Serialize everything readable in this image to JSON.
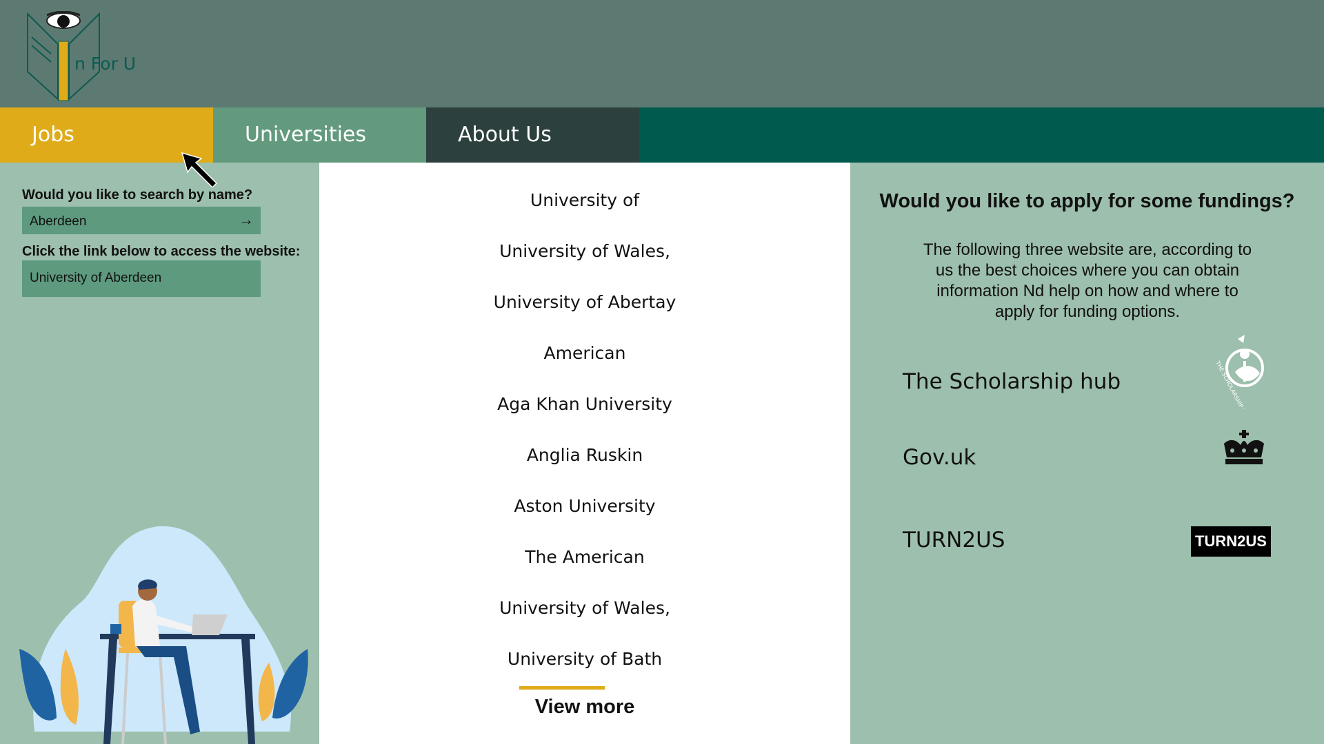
{
  "brand": {
    "logo_text": "n For U"
  },
  "nav": {
    "jobs": "Jobs",
    "universities": "Universities",
    "about": "About Us"
  },
  "left": {
    "search_label": "Would you like to search by name?",
    "search_value": "Aberdeen",
    "search_arrow": "→",
    "link_label": "Click the link below to access the website:",
    "link_value": "University of Aberdeen"
  },
  "universities": {
    "items": [
      "University of",
      "University of Wales,",
      "University of Abertay",
      "American",
      "Aga Khan University",
      "Anglia Ruskin",
      "Aston University",
      "The American",
      "University of Wales,",
      "University of Bath"
    ],
    "view_more": "View more"
  },
  "funding": {
    "title": "Would you like to apply for some fundings?",
    "description": "The following three website are, according to us the best choices where you can obtain information Nd help on how and where to apply for funding options.",
    "sites": [
      "The Scholarship hub",
      "Gov.uk",
      "TURN2US"
    ],
    "scholarship_logo_text": "THE SCHOLARSHIP HUB",
    "turn2us_logo_text": "TURN2US"
  },
  "colors": {
    "header": "#5d7a72",
    "nav": "#005a4d",
    "jobs": "#e0ab19",
    "universities": "#639a7d",
    "about": "#2c403e",
    "panel": "#9dbfad"
  }
}
